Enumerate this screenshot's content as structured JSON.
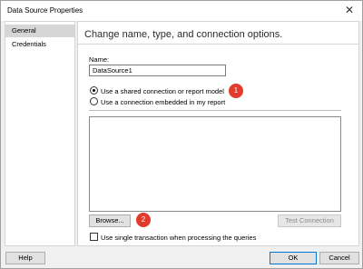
{
  "window": {
    "title": "Data Source Properties"
  },
  "sidebar": {
    "items": [
      {
        "label": "General"
      },
      {
        "label": "Credentials"
      }
    ]
  },
  "main": {
    "heading": "Change name, type, and connection options.",
    "name_label": "Name:",
    "name_value": "DataSource1",
    "radio_shared": "Use a shared connection or report model",
    "radio_embedded": "Use a connection embedded in my report",
    "browse_label": "Browse...",
    "test_connection_label": "Test Connection",
    "single_transaction_label": "Use single transaction when processing the queries",
    "callouts": [
      "1",
      "2"
    ]
  },
  "footer": {
    "help_label": "Help",
    "ok_label": "OK",
    "cancel_label": "Cancel"
  },
  "colors": {
    "callout": "#e23a2b",
    "primary_border": "#0078d7"
  }
}
